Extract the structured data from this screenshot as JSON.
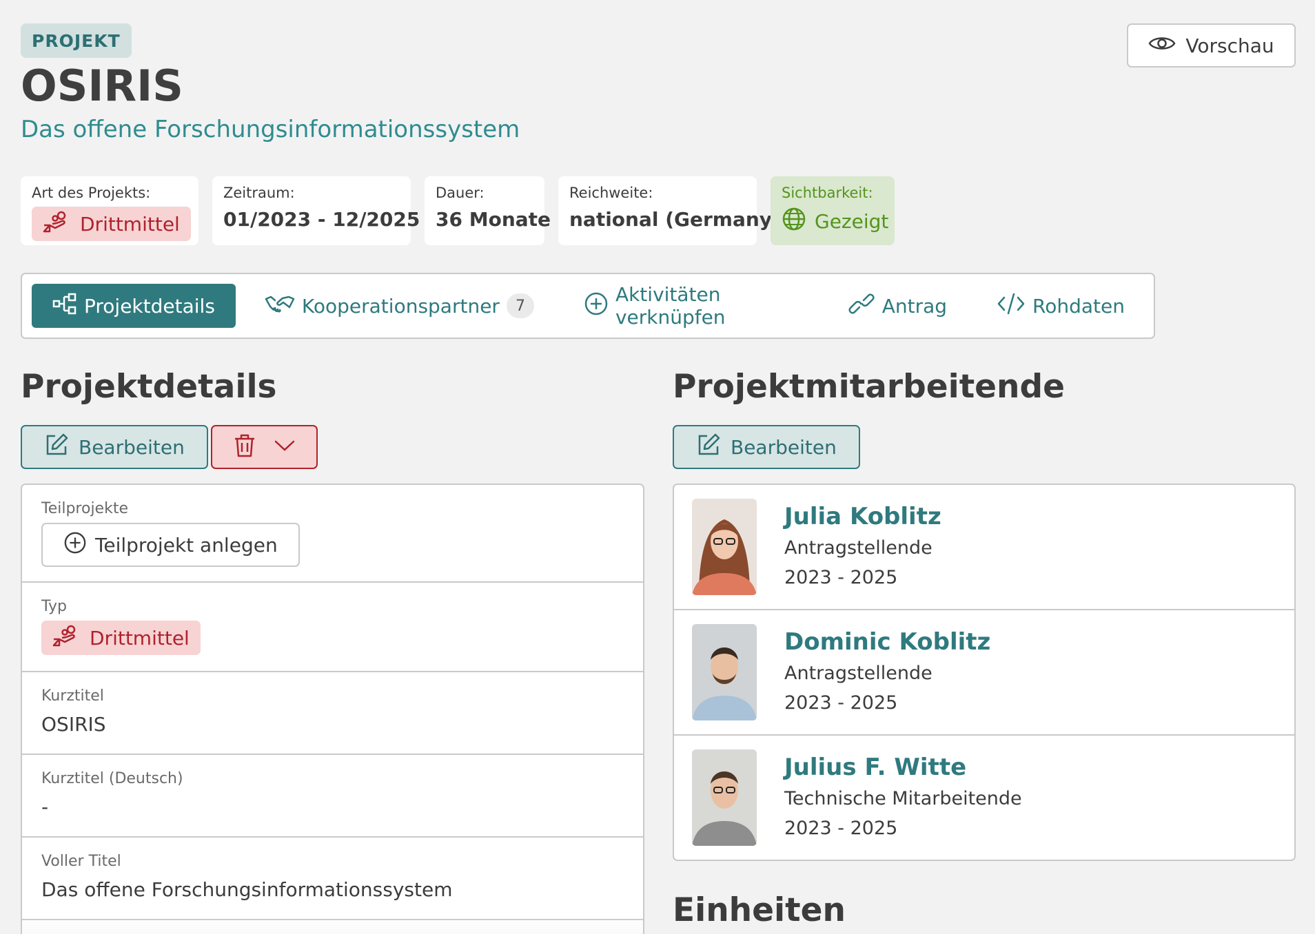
{
  "header": {
    "type_badge": "PROJEKT",
    "title": "OSIRIS",
    "subtitle": "Das offene Forschungsinformationssystem",
    "preview_label": "Vorschau"
  },
  "info": {
    "art_label": "Art des Projekts:",
    "art_value": "Drittmittel",
    "zeitraum_label": "Zeitraum:",
    "zeitraum_value": "01/2023 - 12/2025",
    "dauer_label": "Dauer:",
    "dauer_value": "36 Monate",
    "reichweite_label": "Reichweite:",
    "reichweite_value": "national (Germany)",
    "sichtbarkeit_label": "Sichtbarkeit:",
    "sichtbarkeit_value": "Gezeigt"
  },
  "tabs": [
    {
      "label": "Projektdetails",
      "icon": "tree-structure-icon",
      "active": true
    },
    {
      "label": "Kooperationspartner",
      "icon": "handshake-icon",
      "count": "7"
    },
    {
      "label": "Aktivitäten verknüpfen",
      "icon": "plus-circle-icon"
    },
    {
      "label": "Antrag",
      "icon": "link-icon"
    },
    {
      "label": "Rohdaten",
      "icon": "code-icon"
    }
  ],
  "details": {
    "heading": "Projektdetails",
    "edit_label": "Bearbeiten",
    "rows": {
      "teilprojekte_label": "Teilprojekte",
      "teilprojekt_button": "Teilprojekt anlegen",
      "typ_label": "Typ",
      "typ_value": "Drittmittel",
      "kurztitel_label": "Kurztitel",
      "kurztitel_value": "OSIRIS",
      "kurztitel_de_label": "Kurztitel (Deutsch)",
      "kurztitel_de_value": "-",
      "voller_titel_label": "Voller Titel",
      "voller_titel_value": "Das offene Forschungsinformationssystem"
    }
  },
  "members": {
    "heading": "Projektmitarbeitende",
    "edit_label": "Bearbeiten",
    "list": [
      {
        "name": "Julia Koblitz",
        "role": "Antragstellende",
        "years": "2023 - 2025"
      },
      {
        "name": "Dominic Koblitz",
        "role": "Antragstellende",
        "years": "2023 - 2025"
      },
      {
        "name": "Julius F. Witte",
        "role": "Technische Mitarbeitende",
        "years": "2023 - 2025"
      }
    ]
  },
  "units": {
    "heading": "Einheiten"
  },
  "colors": {
    "accent": "#2f7a7e",
    "danger": "#b0222b",
    "success": "#55931d",
    "background": "#f2f2f2"
  }
}
